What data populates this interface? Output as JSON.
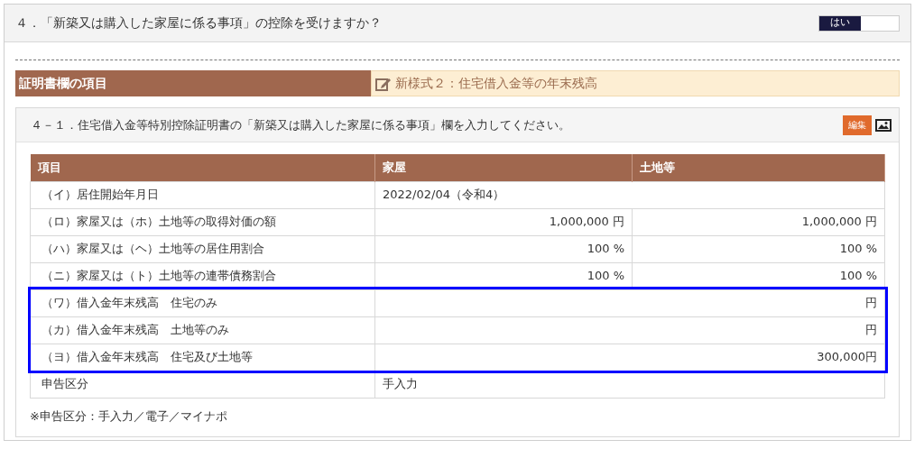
{
  "question": {
    "text": "４．「新築又は購入した家屋に係る事項」の控除を受けますか？",
    "toggle": {
      "label": "はい",
      "on": true
    }
  },
  "section_bar": {
    "label": "証明書欄の項目",
    "value": "新様式２：住宅借入金等の年末残高"
  },
  "card": {
    "title": "４－１．住宅借入金等特別控除証明書の「新築又は購入した家屋に係る事項」欄を入力してください。",
    "edit_button": "編集",
    "table": {
      "columns": [
        "項目",
        "家屋",
        "土地等"
      ],
      "rows": [
        {
          "kind": "span-left",
          "label": "（イ）居住開始年月日",
          "values": [
            "2022/02/04（令和4）"
          ],
          "highlighted": false
        },
        {
          "kind": "split",
          "label": "（ロ）家屋又は（ホ）土地等の取得対価の額",
          "values": [
            "1,000,000 円",
            "1,000,000 円"
          ],
          "highlighted": false
        },
        {
          "kind": "split",
          "label": "（ハ）家屋又は（ヘ）土地等の居住用割合",
          "values": [
            "100 %",
            "100 %"
          ],
          "highlighted": false
        },
        {
          "kind": "split",
          "label": "（ニ）家屋又は（ト）土地等の連帯債務割合",
          "values": [
            "100 %",
            "100 %"
          ],
          "highlighted": false
        },
        {
          "kind": "span-right",
          "label": "（ワ）借入金年末残高　住宅のみ",
          "values": [
            "円"
          ],
          "highlighted": true
        },
        {
          "kind": "span-right",
          "label": "（カ）借入金年末残高　土地等のみ",
          "values": [
            "円"
          ],
          "highlighted": true
        },
        {
          "kind": "span-right",
          "label": "（ヨ）借入金年末残高　住宅及び土地等",
          "values": [
            "300,000円"
          ],
          "highlighted": true
        },
        {
          "kind": "span-left",
          "label": "申告区分",
          "values": [
            "手入力"
          ],
          "highlighted": false
        }
      ]
    },
    "note": "※申告区分：手入力／電子／マイナポ"
  }
}
